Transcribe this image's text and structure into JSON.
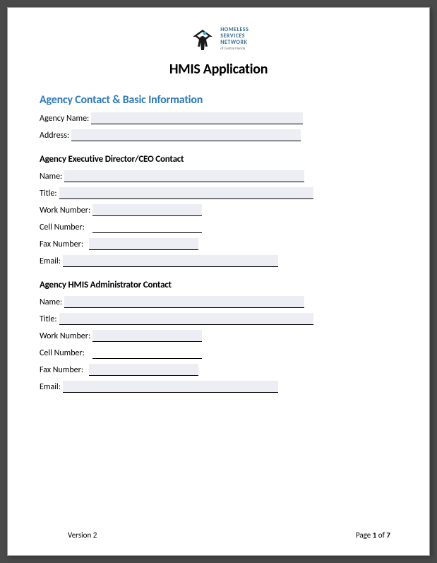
{
  "logo": {
    "line1": "HOMELESS",
    "line2": "SERVICES",
    "line3": "NETWORK",
    "sub": "of Central Florida"
  },
  "title": "HMIS Application",
  "section1": {
    "heading": "Agency Contact & Basic Information",
    "fields": {
      "agency_name": "Agency Name:",
      "address": "Address:"
    }
  },
  "section2": {
    "heading": "Agency Executive Director/CEO Contact",
    "fields": {
      "name": "Name:",
      "title": "Title:",
      "work": "Work Number:",
      "cell": "Cell Number:",
      "fax": "Fax Number:",
      "email": "Email:"
    }
  },
  "section3": {
    "heading": "Agency HMIS Administrator Contact",
    "fields": {
      "name": "Name:",
      "title": "Title:",
      "work": "Work Number:",
      "cell": "Cell Number:",
      "fax": "Fax Number:",
      "email": "Email:"
    }
  },
  "footer": {
    "version": "Version 2",
    "page_label": "Page ",
    "page_current": "1",
    "page_sep": " of ",
    "page_total": "7"
  }
}
